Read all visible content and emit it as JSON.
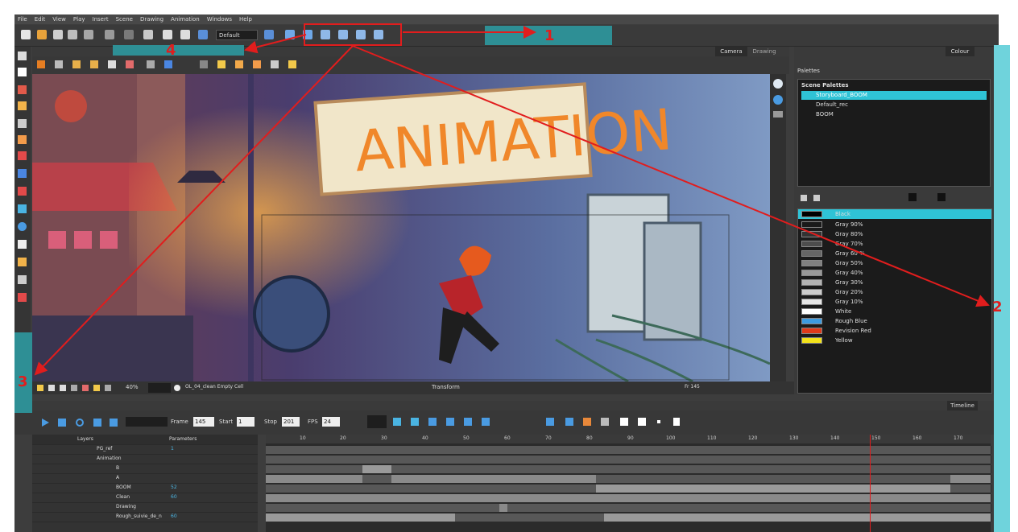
{
  "menu": [
    "File",
    "Edit",
    "View",
    "Play",
    "Insert",
    "Scene",
    "Drawing",
    "Animation",
    "Windows",
    "Help"
  ],
  "toolbar": {
    "preset": "Default"
  },
  "camera": {
    "tab_camera": "Camera",
    "tab_drawing": "Drawing",
    "zoom": "40%",
    "cell_info": "OL_04_clean Empty Cell",
    "mode": "Transform",
    "frame_info": "Fr 145"
  },
  "sign_text": "ANIMATION",
  "colour": {
    "tab": "Colour",
    "palettes_label": "Palettes",
    "scene_palettes": "Scene Palettes",
    "palettes": [
      "Storyboard_BOOM",
      "Default_rec",
      "BOOM"
    ],
    "swatches": [
      {
        "name": "Black",
        "color": "#000000"
      },
      {
        "name": "Gray 90%",
        "color": "#1a1a1a"
      },
      {
        "name": "Gray 80%",
        "color": "#333333"
      },
      {
        "name": "Gray 70%",
        "color": "#4d4d4d"
      },
      {
        "name": "Gray 60 %",
        "color": "#666666"
      },
      {
        "name": "Gray 50%",
        "color": "#808080"
      },
      {
        "name": "Gray 40%",
        "color": "#999999"
      },
      {
        "name": "Gray 30%",
        "color": "#b3b3b3"
      },
      {
        "name": "Gray 20%",
        "color": "#cccccc"
      },
      {
        "name": "Gray 10%",
        "color": "#e6e6e6"
      },
      {
        "name": "White",
        "color": "#ffffff"
      },
      {
        "name": "Rough Blue",
        "color": "#3d9be0"
      },
      {
        "name": "Revision Red",
        "color": "#e03a1a"
      },
      {
        "name": "Yellow",
        "color": "#f2e21a"
      }
    ]
  },
  "timeline": {
    "tab": "Timeline",
    "frame_label": "Frame",
    "frame_value": "145",
    "start_label": "Start",
    "start_value": "1",
    "stop_label": "Stop",
    "stop_value": "201",
    "fps_label": "FPS",
    "fps_value": "24",
    "layers_label": "Layers",
    "parameters_label": "Parameters",
    "ruler": [
      "10",
      "20",
      "30",
      "40",
      "50",
      "60",
      "70",
      "80",
      "90",
      "100",
      "110",
      "120",
      "130",
      "140",
      "150",
      "160",
      "170"
    ],
    "layers": [
      {
        "name": "PG_ref",
        "param": "1"
      },
      {
        "name": "Animation",
        "param": ""
      },
      {
        "name": "B",
        "param": ""
      },
      {
        "name": "A",
        "param": ""
      },
      {
        "name": "BOOM",
        "param": "52"
      },
      {
        "name": "Clean",
        "param": "60"
      },
      {
        "name": "Drawing",
        "param": ""
      },
      {
        "name": "Rough_suivie_de_n",
        "param": "60"
      }
    ]
  },
  "annotations": [
    "1",
    "2",
    "3",
    "4"
  ]
}
